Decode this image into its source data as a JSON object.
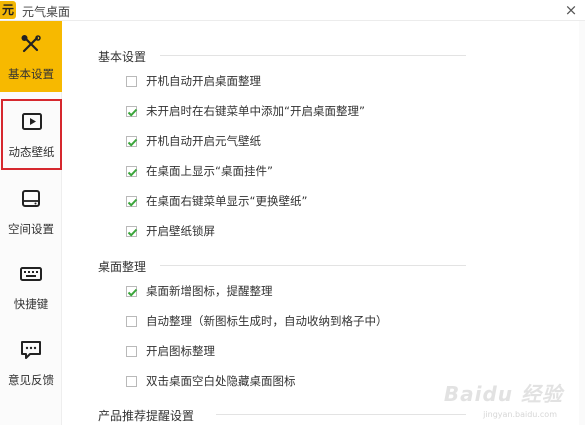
{
  "window": {
    "logo_text": "元",
    "title": "元气桌面",
    "close_label": "×"
  },
  "sidebar": {
    "items": [
      {
        "label": "基本设置",
        "icon": "tools-icon",
        "state": "active"
      },
      {
        "label": "动态壁纸",
        "icon": "play-video-icon",
        "state": "highlighted"
      },
      {
        "label": "空间设置",
        "icon": "hard-drive-icon",
        "state": "normal"
      },
      {
        "label": "快捷键",
        "icon": "keyboard-icon",
        "state": "normal"
      },
      {
        "label": "意见反馈",
        "icon": "chat-bubble-icon",
        "state": "normal"
      }
    ],
    "accent_color": "#f7b900",
    "highlight_border_color": "#d6282e"
  },
  "sections": [
    {
      "title": "基本设置",
      "options": [
        {
          "label": "开机自动开启桌面整理",
          "checked": false
        },
        {
          "label": "未开启时在右键菜单中添加“开启桌面整理”",
          "checked": true
        },
        {
          "label": "开机自动开启元气壁纸",
          "checked": true
        },
        {
          "label": "在桌面上显示“桌面挂件”",
          "checked": true
        },
        {
          "label": "在桌面右键菜单显示“更换壁纸”",
          "checked": true
        },
        {
          "label": "开启壁纸锁屏",
          "checked": true
        }
      ]
    },
    {
      "title": "桌面整理",
      "options": [
        {
          "label": "桌面新增图标，提醒整理",
          "checked": true
        },
        {
          "label": "自动整理（新图标生成时，自动收纳到格子中）",
          "checked": false
        },
        {
          "label": "开启图标整理",
          "checked": false
        },
        {
          "label": "双击桌面空白处隐藏桌面图标",
          "checked": false
        }
      ]
    },
    {
      "title": "产品推荐提醒设置",
      "options": []
    }
  ],
  "checkbox_color": "#3aa53a",
  "watermark": {
    "text": "Baidu 经验",
    "sub": "jingyan.baidu.com"
  }
}
